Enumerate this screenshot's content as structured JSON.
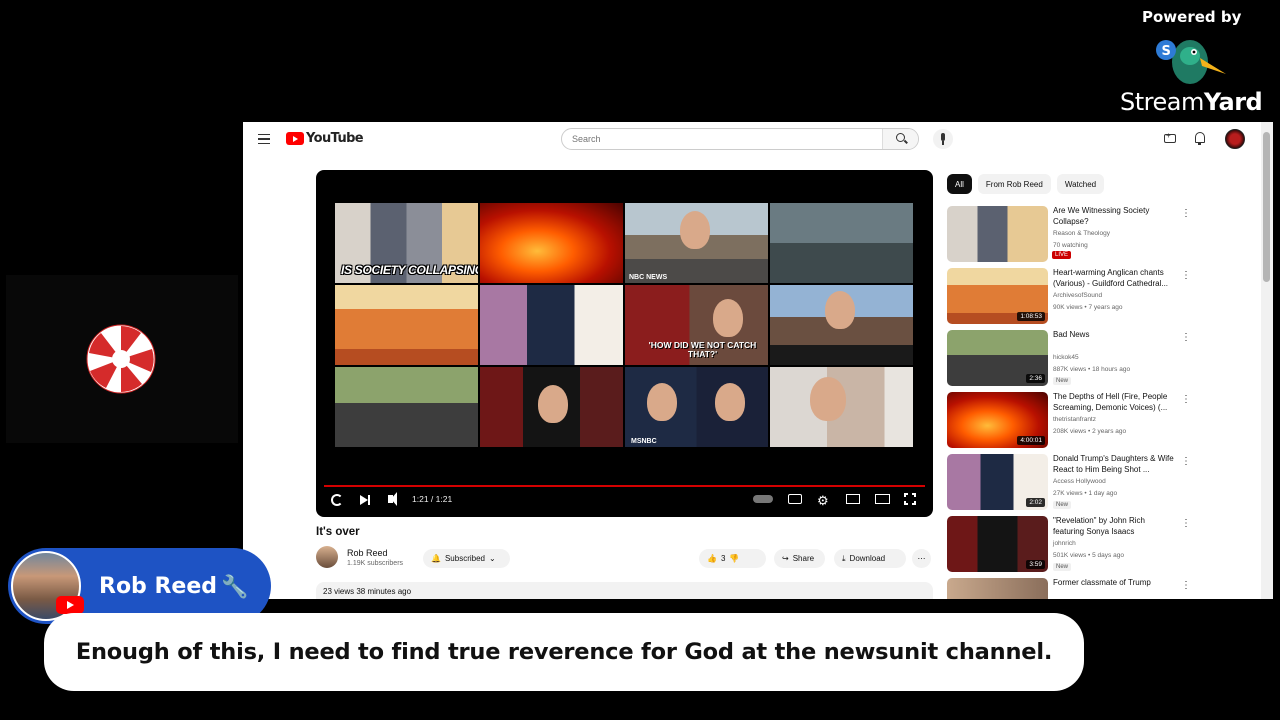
{
  "branding": {
    "powered_by": "Powered by",
    "wordmark_part1": "Stream",
    "wordmark_part2": "Yard"
  },
  "youtube": {
    "logo_text": "YouTube",
    "search_placeholder": "Search",
    "video": {
      "collage_captions": {
        "society": "IS SOCIETY COLLAPSING?",
        "nbc": "NBC NEWS",
        "catch": "'HOW DID WE NOT CATCH THAT?'",
        "msnbc": "MSNBC"
      },
      "time": "1:21 / 1:21",
      "progress_fraction": 1.0,
      "title": "It's over",
      "channel": "Rob Reed",
      "subscribers": "1.19K subscribers",
      "subscribe_label": "Subscribed",
      "likes": "3",
      "share_label": "Share",
      "download_label": "Download",
      "views_time": "23 views  38 minutes ago"
    },
    "chips": [
      "All",
      "From Rob Reed",
      "Watched"
    ],
    "recommendations": [
      {
        "title": "Are We Witnessing Society Collapse?",
        "channel": "Reason & Theology",
        "meta": "70 watching",
        "badge": "LIVE",
        "duration": "",
        "new": ""
      },
      {
        "title": "Heart-warming Anglican chants (Various) - Guildford Cathedral...",
        "channel": "ArchivesofSound",
        "meta": "90K views • 7 years ago",
        "badge": "",
        "duration": "1:08:53",
        "new": ""
      },
      {
        "title": "Bad News",
        "channel": "hickok45",
        "meta": "887K views • 18 hours ago",
        "badge": "",
        "duration": "2:36",
        "new": "New"
      },
      {
        "title": "The Depths of Hell (Fire, People Screaming, Demonic Voices) (...",
        "channel": "thetristanfrantz",
        "meta": "208K views • 2 years ago",
        "badge": "",
        "duration": "4:00:01",
        "new": ""
      },
      {
        "title": "Donald Trump's Daughters & Wife React to Him Being Shot ...",
        "channel": "Access Hollywood",
        "meta": "27K views • 1 day ago",
        "badge": "",
        "duration": "2:02",
        "new": "New"
      },
      {
        "title": "\"Revelation\" by John Rich featuring Sonya Isaacs",
        "channel": "johnrich",
        "meta": "501K views • 5 days ago",
        "badge": "",
        "duration": "3:59",
        "new": "New"
      },
      {
        "title": "Former classmate of Trump",
        "channel": "",
        "meta": "",
        "badge": "",
        "duration": "",
        "new": ""
      }
    ]
  },
  "host": {
    "name": "Rob Reed"
  },
  "banner": {
    "text": "Enough of this, I need to find true reverence for God at the newsunit channel."
  },
  "colors": {
    "nametag": "#1e53c4",
    "youtube_red": "#ff0000",
    "stage_bg": "#000000"
  }
}
